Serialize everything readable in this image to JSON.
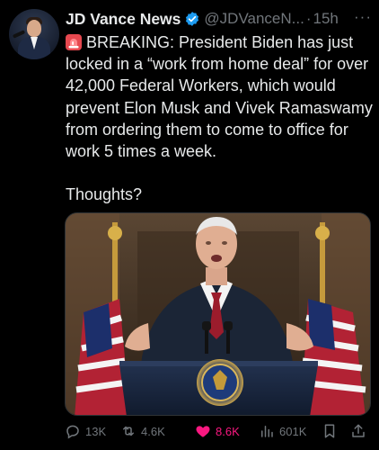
{
  "author": {
    "name": "JD Vance News",
    "handle": "@JDVanceN...",
    "separator": "·",
    "time": "15h",
    "more": "···"
  },
  "tweet": {
    "body": "BREAKING: President Biden has just locked in a “work from home deal” for over 42,000 Federal Workers, which would prevent Elon Musk and Vivek Ramaswamy from ordering them to come to office for work 5 times a week.\n\nThoughts?"
  },
  "actions": {
    "reply_count": "13K",
    "repost_count": "4.6K",
    "like_count": "8.6K",
    "views_count": "601K"
  },
  "colors": {
    "background": "#000000",
    "text": "#e7e9ea",
    "muted": "#71767b",
    "verified": "#1d9bf0",
    "like": "#f91880"
  },
  "icons": [
    "verified-badge-icon",
    "siren-emoji-icon",
    "reply-icon",
    "repost-icon",
    "like-icon",
    "views-icon",
    "bookmark-icon",
    "share-icon",
    "more-icon"
  ]
}
